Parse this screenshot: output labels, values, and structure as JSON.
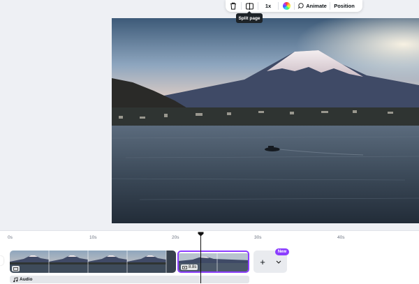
{
  "toolbar": {
    "delete_icon": "trash-icon",
    "split_icon": "split-icon",
    "speed_label": "1x",
    "color_icon": "color-wheel-icon",
    "animate_label": "Animate",
    "position_label": "Position"
  },
  "tooltip": {
    "text": "Split page"
  },
  "timeline": {
    "ticks": [
      "0s",
      "10s",
      "20s",
      "30s",
      "40s"
    ],
    "clip_duration": "8.8s",
    "add_label": "+",
    "new_badge": "New",
    "audio_label": "Audio"
  },
  "colors": {
    "accent": "#8b3dff",
    "toolbar_bg": "#ffffff",
    "timeline_bg": "#ffffff"
  }
}
